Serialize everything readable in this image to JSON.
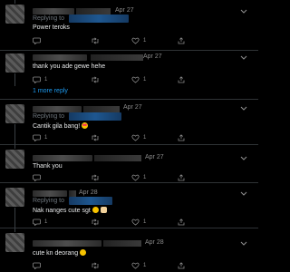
{
  "tweets": [
    {
      "date": "Apr 27",
      "replying_to": "Replying to",
      "text": "Power teroks",
      "reply_count": "",
      "retweet_count": "",
      "like_count": "1"
    },
    {
      "date": "Apr 27",
      "text": "thank you ade gewe hehe",
      "reply_count": "1",
      "retweet_count": "",
      "like_count": "1",
      "more_replies": "1 more reply"
    },
    {
      "date": "Apr 27",
      "replying_to": "Replying to",
      "text": "Cantik gila bang!",
      "emoji": "heart-eyes-emoji",
      "reply_count": "1",
      "retweet_count": "",
      "like_count": "1"
    },
    {
      "date": "Apr 27",
      "text": "Thank you",
      "reply_count": "",
      "retweet_count": "",
      "like_count": "1"
    },
    {
      "date": "Apr 28",
      "replying_to": "Replying to",
      "text": "Nak nanges cute sgt",
      "emoji": "smiling-emoji + rock-hand-emoji",
      "reply_count": "1",
      "retweet_count": "",
      "like_count": "1"
    },
    {
      "date": "Apr 28",
      "text": "cute kn deorang",
      "emoji": "grin-emoji",
      "reply_count": "",
      "retweet_count": "",
      "like_count": "1"
    }
  ],
  "colors": {
    "background": "#000000",
    "link": "#1d9bf0",
    "muted": "#8b8b8b",
    "text": "#e7e9ea"
  },
  "icons": [
    "reply-icon",
    "retweet-icon",
    "like-icon",
    "share-icon",
    "chevron-down-icon"
  ]
}
